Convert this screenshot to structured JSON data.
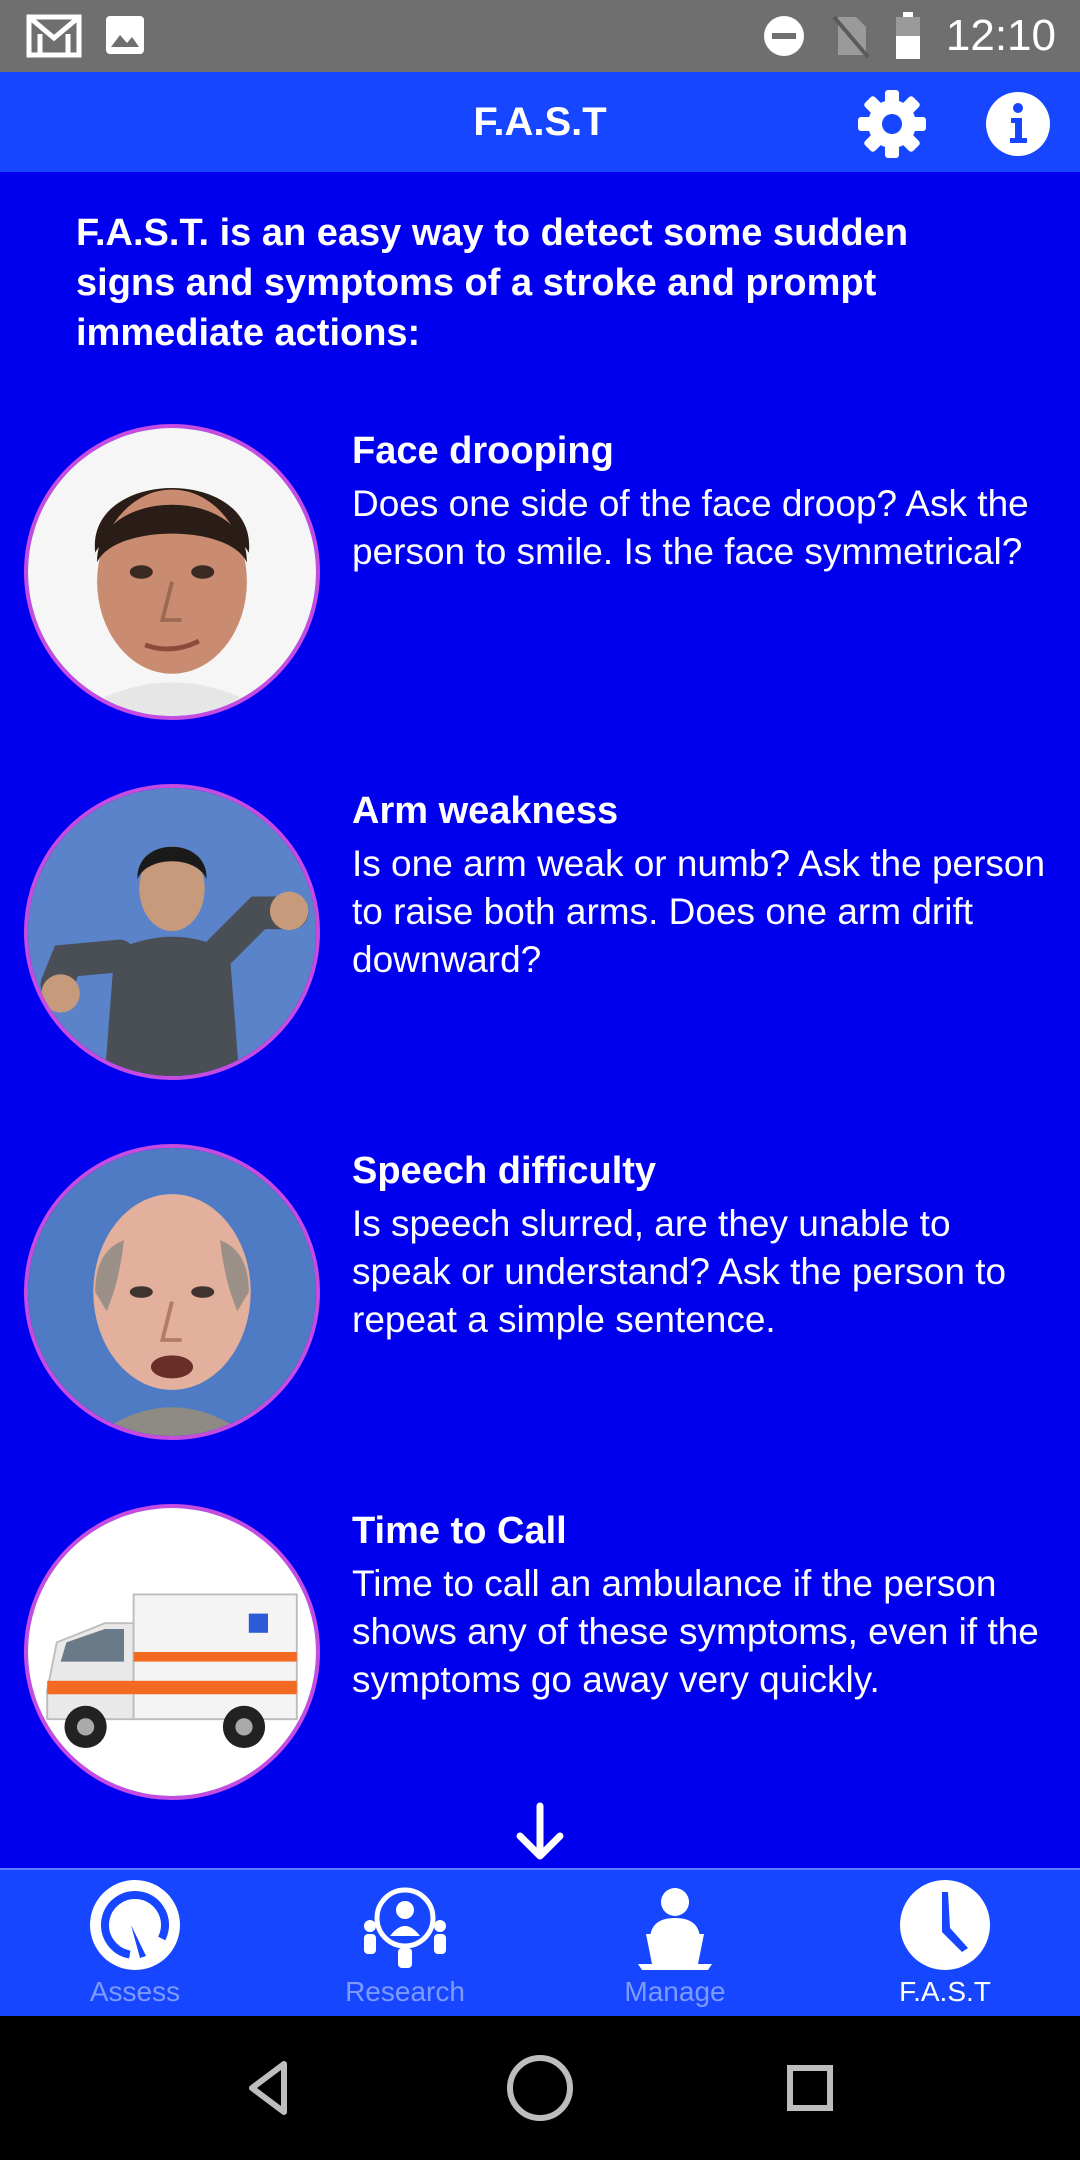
{
  "status_bar": {
    "time": "12:10",
    "icons": [
      "gmail-icon",
      "image-icon",
      "do-not-disturb-icon",
      "no-sim-icon",
      "battery-icon"
    ]
  },
  "app_bar": {
    "title": "F.A.S.T",
    "icons": [
      "gear-icon",
      "info-icon"
    ]
  },
  "intro": "F.A.S.T. is an easy way to detect some sudden signs and symptoms of a stroke and prompt immediate actions:",
  "items": [
    {
      "title": "Face drooping",
      "description": "Does one side of the face droop? Ask the person to smile. Is the face symmetrical?",
      "image": "face-photo"
    },
    {
      "title": "Arm weakness",
      "description": "Is one arm weak or numb? Ask the person to raise both arms. Does one arm drift downward?",
      "image": "arms-photo"
    },
    {
      "title": "Speech difficulty",
      "description": "Is speech slurred, are they unable to speak or understand? Ask the person to repeat a simple sentence.",
      "image": "speech-photo"
    },
    {
      "title": "Time to Call",
      "description": "Time to call an ambulance if the person shows any of these symptoms, even if the symptoms go away very quickly.",
      "image": "ambulance-photo"
    }
  ],
  "scroll_icon": "arrow-down-icon",
  "bottom_nav": {
    "items": [
      {
        "label": "Assess",
        "icon": "gauge-icon",
        "active": false
      },
      {
        "label": "Research",
        "icon": "research-group-icon",
        "active": false
      },
      {
        "label": "Manage",
        "icon": "doctor-laptop-icon",
        "active": false
      },
      {
        "label": "F.A.S.T",
        "icon": "clock-icon",
        "active": true
      }
    ]
  },
  "system_nav": {
    "icons": [
      "back-icon",
      "home-icon",
      "recents-icon"
    ]
  },
  "colors": {
    "content_bg": "#0000ee",
    "app_bar_bg": "#1646ff",
    "status_bar_bg": "#6f6f6f",
    "inactive_label": "#7d9bff",
    "avatar_ring": "#c64be0"
  }
}
